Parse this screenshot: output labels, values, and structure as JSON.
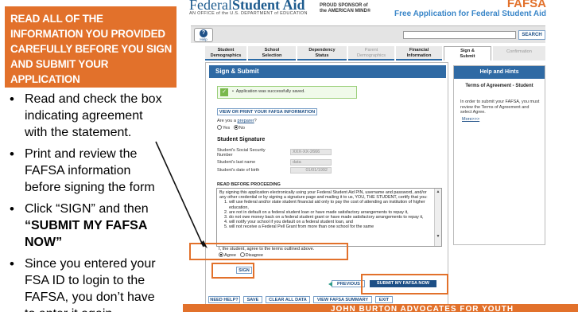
{
  "slide": {
    "heading_lines": [
      "READ ALL OF THE",
      "INFORMATION YOU PROVIDED",
      "CAREFULLY BEFORE YOU SIGN",
      "AND SUBMIT YOUR",
      "APPLICATION"
    ],
    "bullet1_lines": [
      "Read and check the box",
      "indicating agreement",
      "with the statement."
    ],
    "bullet2_lines": [
      "Print and review the",
      "FAFSA information",
      "before signing the form"
    ],
    "bullet3_line1": "Click “SIGN” and then",
    "bullet3_line2": "“SUBMIT MY FAFSA",
    "bullet3_line3": "NOW”",
    "bullet4_lines": [
      "Since you entered your",
      "FSA ID to login to the",
      "FAFSA, you don’t have",
      "to enter it again."
    ],
    "footer_banner": "JOHN BURTON ADVOCATES FOR YOUTH"
  },
  "fafsa": {
    "logo_prefix": "Federal",
    "logo_bold": "Student Aid",
    "logo_sub": "AN OFFICE of the U.S. DEPARTMENT of EDUCATION",
    "sponsor_line1": "PROUD SPONSOR of",
    "sponsor_line2": "the AMERICAN MIND®",
    "fafsa_word": "FAFSA",
    "tagline": "Free Application for Federal Student Aid",
    "help_label": "Help",
    "search_label": "SEARCH",
    "tabs": [
      {
        "line1": "Student",
        "line2": "Demographics"
      },
      {
        "line1": "School",
        "line2": "Selection"
      },
      {
        "line1": "Dependency",
        "line2": "Status"
      },
      {
        "line1": "Parent",
        "line2": "Demographics"
      },
      {
        "line1": "Financial",
        "line2": "Information"
      },
      {
        "line1": "Sign &",
        "line2": "Submit"
      },
      {
        "line1": "Confirmation",
        "line2": ""
      }
    ],
    "section_title": "Sign & Submit",
    "success_msg": "Application was successfully saved.",
    "view_print_btn": "VIEW OR PRINT YOUR FAFSA INFORMATION",
    "preparer_q_prefix": "Are you a ",
    "preparer_link": "preparer",
    "preparer_q_suffix": "?",
    "yes_label": "Yes",
    "no_label": "No",
    "student_signature": "Student Signature",
    "ssn_label_1": "Student's Social Security",
    "ssn_label_2": "Number",
    "ssn_value": "XXX-XX-2666",
    "last_name_label": "Student's last name",
    "last_name_value": "data",
    "dob_label": "Student's date of birth",
    "dob_value": "01/01/1992",
    "read_before": "READ BEFORE PROCEEDING",
    "agreement_intro": "By signing this application electronically using your Federal Student Aid PIN, username and password, and/or any other credential or by signing a signature page and mailing it to us, YOU, THE STUDENT, certify that you:",
    "agreement_items": [
      "will use federal and/or state student financial aid only to pay the cost of attending an institution of higher education,",
      "are not in default on a federal student loan or have made satisfactory arrangements to repay it,",
      "do not owe money back on a federal student grant or have made satisfactory arrangements to repay it,",
      "will notify your school if you default on a federal student loan, and",
      "will not receive a Federal Pell Grant from more than one school for the same"
    ],
    "agree_statement": "I, the student, agree to the terms outlined above.",
    "agree_label": "Agree",
    "disagree_label": "Disagree",
    "sign_btn": "SIGN",
    "previous_btn": "PREVIOUS",
    "submit_btn": "SUBMIT MY FAFSA NOW",
    "bottom_btns": [
      "NEED HELP?",
      "SAVE",
      "CLEAR ALL DATA",
      "VIEW FAFSA SUMMARY",
      "EXIT"
    ],
    "hints_head": "Help and Hints",
    "hints_title": "Terms of Agreement - Student",
    "hints_body": "In order to submit your FAFSA, you must review the Terms of Agreement and select Agree.",
    "hints_more": "More>>>"
  },
  "colors": {
    "accent_orange": "#e2712b",
    "fafsa_blue": "#2f6aa4",
    "link_blue": "#1d4f86"
  }
}
